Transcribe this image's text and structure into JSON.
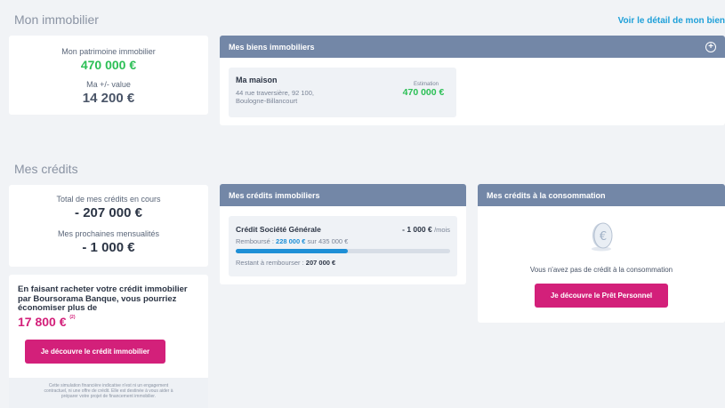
{
  "immo": {
    "title": "Mon immobilier",
    "detail_link": "Voir le détail de mon bien",
    "patrimoine_label": "Mon patrimoine immobilier",
    "patrimoine_value": "470 000 €",
    "plus_value_label": "Ma +/- value",
    "plus_value_value": "14 200 €",
    "biens_panel_title": "Mes biens immobiliers",
    "bien": {
      "name": "Ma maison",
      "address_line1": "44 rue traversière, 92 100,",
      "address_line2": "Boulogne-Billancourt",
      "estimation_label": "Estimation",
      "estimation_value": "470 000 €"
    }
  },
  "credits": {
    "title": "Mes crédits",
    "total_label": "Total de mes crédits en cours",
    "total_value": "- 207 000 €",
    "mensualites_label": "Mes prochaines mensualités",
    "mensualites_value": "- 1 000 €",
    "promo": {
      "line1": "En faisant racheter votre crédit immobilier",
      "line2": "par Boursorama Banque, vous pourriez",
      "line3": "économiser plus de",
      "amount": "17 800 €",
      "note_ref": "(2)",
      "button": "Je découvre le crédit immobilier",
      "disclaimer_line1": "Cette simulation financière indicative n'est ni un engagement",
      "disclaimer_line2": "contractuel, ni une offre de crédit. Elle est destinée à vous aider à",
      "disclaimer_line3": "préparer votre projet de financement immobilier."
    },
    "immo_panel": {
      "title": "Mes crédits immobiliers",
      "item": {
        "name": "Crédit Société Générale",
        "monthly_amount": "- 1 000 €",
        "monthly_unit": "/mois",
        "rembourse_label": "Remboursé : ",
        "rembourse_value": "228 000 €",
        "rembourse_suffix": " sur 435 000 €",
        "progress_fraction": 0.524,
        "restant_label": "Restant à rembourser : ",
        "restant_value": "207 000 €"
      }
    },
    "conso_panel": {
      "title": "Mes crédits à la consommation",
      "empty_text": "Vous n'avez pas de crédit à la consommation",
      "button": "Je découvre le Prêt Personnel"
    }
  },
  "colors": {
    "accent_pink": "#d3207a",
    "green": "#2bbf55",
    "blue_link": "#1fa0d9",
    "panel_header": "#7387a7",
    "progress": "#1e8fd6"
  },
  "icons": {
    "add": "plus-circle-icon",
    "credit_empty": "coin-euro-icon"
  }
}
